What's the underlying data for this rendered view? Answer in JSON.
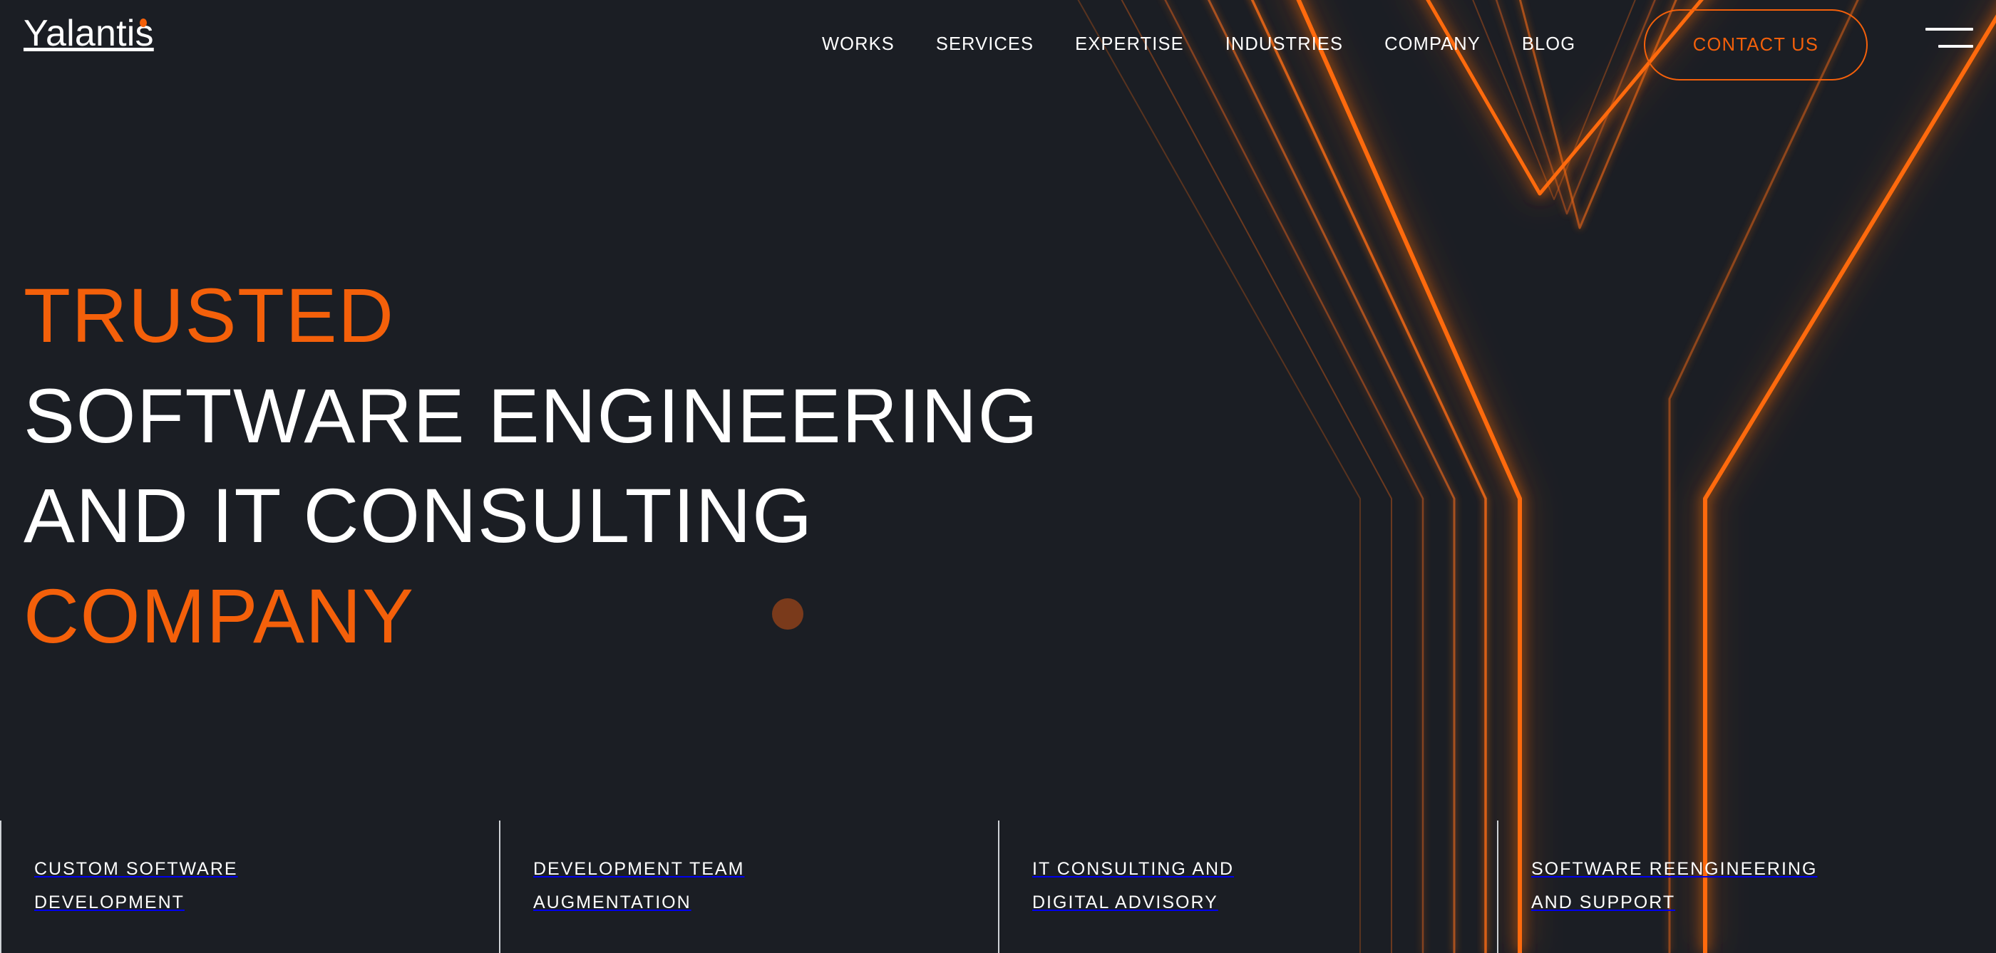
{
  "theme": {
    "background": "#1b1e24",
    "accent": "#f4600a",
    "text": "#ffffff",
    "divider": "#cfd2d6",
    "cursor_dot": "#7a3a1b"
  },
  "header": {
    "logo": "Yalantis",
    "nav": [
      {
        "label": "WORKS"
      },
      {
        "label": "SERVICES"
      },
      {
        "label": "EXPERTISE"
      },
      {
        "label": "INDUSTRIES"
      },
      {
        "label": "COMPANY"
      },
      {
        "label": "BLOG"
      }
    ],
    "cta_label": "CONTACT US",
    "menu_icon": "hamburger-icon"
  },
  "hero": {
    "heading_lines": [
      {
        "text": "TRUSTED",
        "accent": true
      },
      {
        "text": "SOFTWARE ENGINEERING",
        "accent": false
      },
      {
        "text": "AND IT CONSULTING",
        "accent": false
      },
      {
        "text": "COMPANY",
        "accent": true
      }
    ]
  },
  "service_cards": [
    {
      "line1": "CUSTOM SOFTWARE",
      "line2": "DEVELOPMENT"
    },
    {
      "line1": "DEVELOPMENT TEAM",
      "line2": "AUGMENTATION"
    },
    {
      "line1": "IT CONSULTING AND",
      "line2": "DIGITAL ADVISORY"
    },
    {
      "line1": "SOFTWARE REENGINEERING",
      "line2": "AND SUPPORT"
    }
  ]
}
